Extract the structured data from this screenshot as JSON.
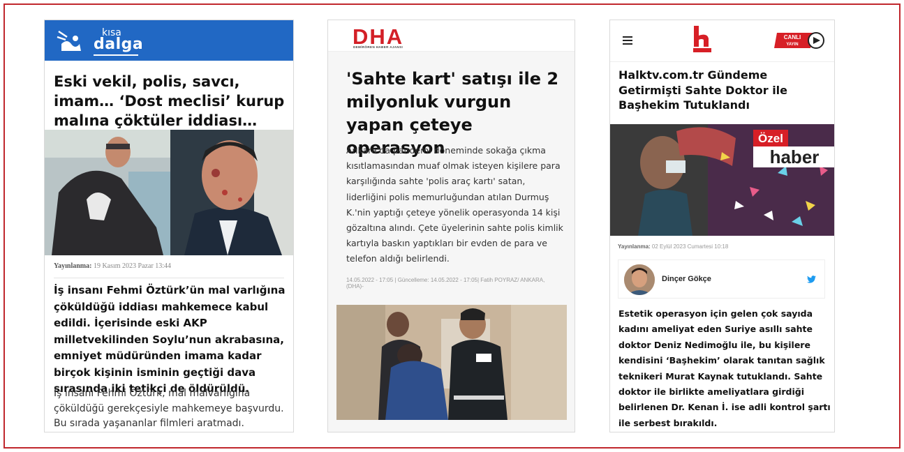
{
  "card1": {
    "logo_small": "kısa",
    "logo_main": "dalga",
    "headline": "Eski vekil, polis, savcı, imam… ‘Dost meclisi’ kurup malına çöktüler iddiası…",
    "date_label": "Yayınlanma:",
    "date_value": "19 Kasım 2023 Pazar 13:44",
    "lead": "İş insanı Fehmi Öztürk’ün mal varlığına çöküldüğü iddiası mahkemece kabul edildi. İçerisinde eski AKP milletvekilinden Soylu’nun akrabasına, emniyet müdüründen imama kadar birçok kişinin isminin geçtiği dava sırasında iki tetikçi de öldürüldü.",
    "body": "İş insanı Fehmi Öztürk, mal malvarlığına çöküldüğü gerekçesiyle mahkemeye başvurdu. Bu sırada yaşananlar filmleri aratmadı."
  },
  "card2": {
    "logo": "DHA",
    "logo_sub": "DEMİRÖREN HABER AJANSI",
    "headline": "'Sahte kart' satışı ile 2 milyonluk vurgun yapan çeteye operasyon",
    "body": "Ankara'da pandemi döneminde sokağa çıkma kısıtlamasından muaf olmak isteyen kişilere para karşılığında sahte 'polis araç kartı' satan, liderliğini polis memurluğundan atılan Durmuş K.'nin yaptığı çeteye yönelik operasyonda 14 kişi gözaltına alındı. Çete üyelerinin sahte polis kimlik kartıyla baskın yaptıkları bir evden de para ve telefon aldığı belirlendi.",
    "meta": "14.05.2022 - 17:05 | Güncelleme: 14.05.2022 - 17:05| Fatih POYRAZ/ ANKARA, (DHA)-"
  },
  "card3": {
    "live_label_1": "CANLI",
    "live_label_2": "YAYIN",
    "headline": "Halktv.com.tr Gündeme Getirmişti Sahte Doktor ile Başhekim Tutuklandı",
    "photo_badge_1": "Özel",
    "photo_badge_2": "haber",
    "date_label": "Yayınlanma:",
    "date_value": "02 Eylül 2023 Cumartesi 10:18",
    "author": "Dinçer Gökçe",
    "lead": "Estetik operasyon için gelen çok sayıda kadını ameliyat eden Suriye asıllı sahte doktor Deniz Nedimoğlu ile, bu kişilere kendisini ‘Başhekim’ olarak tanıtan sağlık teknikeri Murat Kaynak tutuklandı. Sahte doktor ile birlikte ameliyatlara girdiği belirlenen Dr. Kenan İ. ise adli kontrol şartı ile serbest bırakıldı."
  },
  "colors": {
    "frame": "#c0272d",
    "kisadalga_blue": "#2168c4",
    "dha_red": "#d32027",
    "halktv_red": "#d71f26"
  }
}
